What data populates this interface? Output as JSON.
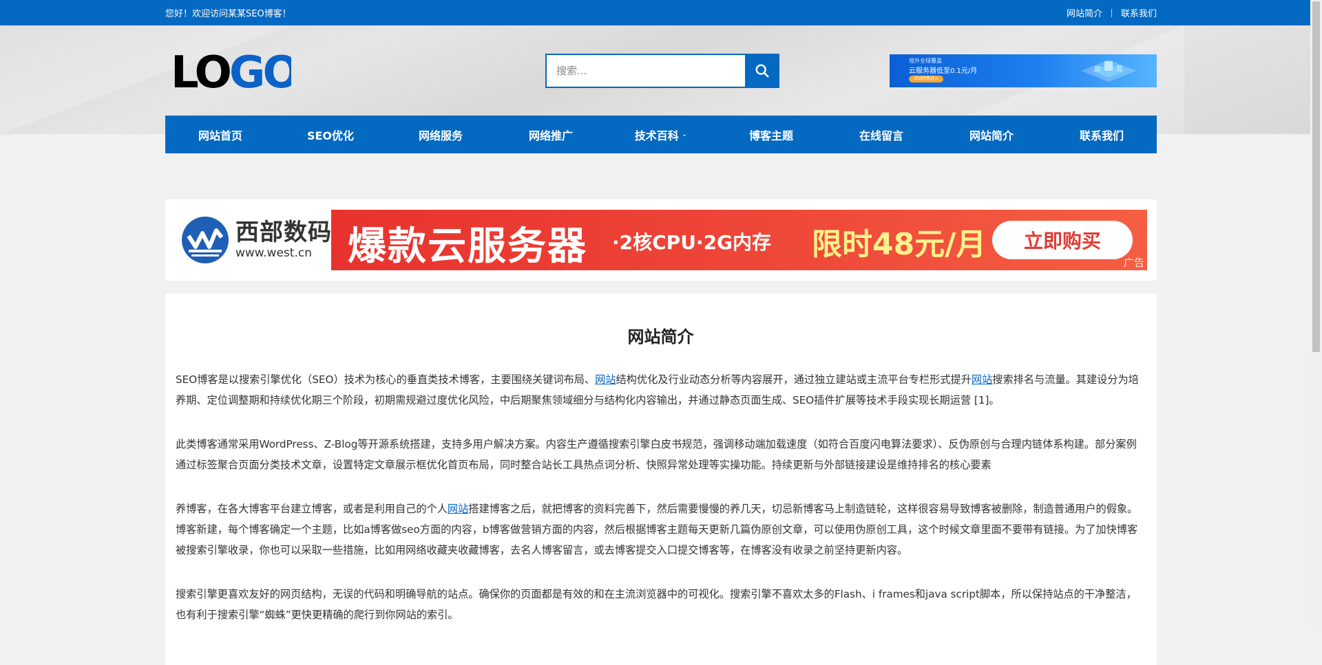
{
  "topbar": {
    "welcome": "您好！欢迎访问某某SEO博客！",
    "links": [
      "网站简介",
      "联系我们"
    ]
  },
  "header": {
    "logo_text": "LOGO",
    "search_placeholder": "搜索...",
    "banner": {
      "line1": "境外全球覆盖",
      "line2": "云服务器低至0.1元/月",
      "button": "活动特惠进入"
    }
  },
  "nav": [
    {
      "label": "网站首页"
    },
    {
      "label": "SEO优化"
    },
    {
      "label": "网络服务"
    },
    {
      "label": "网络推广"
    },
    {
      "label": "技术百科"
    },
    {
      "label": "博客主题"
    },
    {
      "label": "在线留言"
    },
    {
      "label": "网站简介"
    },
    {
      "label": "联系我们"
    }
  ],
  "ad": {
    "brand_cn": "西部数码",
    "brand_url": "www.west.cn",
    "headline": "爆款云服务器",
    "spec": "·2核CPU·2G内存",
    "price": "限时48元/月",
    "button": "立即购买",
    "tag": "广告"
  },
  "article": {
    "title": "网站简介",
    "p1": {
      "a": "SEO博客是以搜索引擎优化（SEO）技术为核心的垂直类技术博客，主要围绕关键词布局、",
      "link1": "网站",
      "b": "结构优化及行业动态分析等内容展开，通过独立建站或主流平台专栏形式提升",
      "link2": "网站",
      "c": "搜索排名与流量。其建设分为培养期、定位调整期和持续优化期三个阶段，初期需规避过度优化风险，中后期聚焦领域细分与结构化内容输出，并通过静态页面生成、SEO插件扩展等技术手段实现长期运营 [1]。"
    },
    "p2": "此类博客通常采用WordPress、Z-Blog等开源系统搭建，支持多用户解决方案。内容生产遵循搜索引擎白皮书规范，强调移动端加载速度（如符合百度闪电算法要求）、反伪原创与合理内链体系构建。部分案例通过标签聚合页面分类技术文章，设置特定文章展示框优化首页布局，同时整合站长工具热点词分析、快照异常处理等实操功能。持续更新与外部链接建设是维持排名的核心要素",
    "p3": {
      "a": "养博客，在各大博客平台建立博客，或者是利用自己的个人",
      "link": "网站",
      "b": "搭建博客之后，就把博客的资料完善下，然后需要慢慢的养几天，切忌新博客马上制造链轮，这样很容易导致博客被删除，制造普通用户的假象。博客新建，每个博客确定一个主题，比如a博客做seo方面的内容，b博客做营销方面的内容，然后根据博客主题每天更新几篇伪原创文章，可以使用伪原创工具，这个时候文章里面不要带有链接。为了加快博客被搜索引擎收录，你也可以采取一些措施，比如用网络收藏夹收藏博客，去名人博客留言，或去博客提交入口提交博客等，在博客没有收录之前坚持更新内容。"
    },
    "p4": "搜索引擎更喜欢友好的网页结构，无误的代码和明确导航的站点。确保你的页面都是有效的和在主流浏览器中的可视化。搜索引擎不喜欢太多的Flash、i frames和java script脚本，所以保持站点的干净整洁，也有利于搜索引擎“蜘蛛”更快更精确的爬行到你网站的索引。"
  },
  "colors": {
    "primary": "#0469c1",
    "ad_red": "#e8322e",
    "link": "#0066cc"
  }
}
